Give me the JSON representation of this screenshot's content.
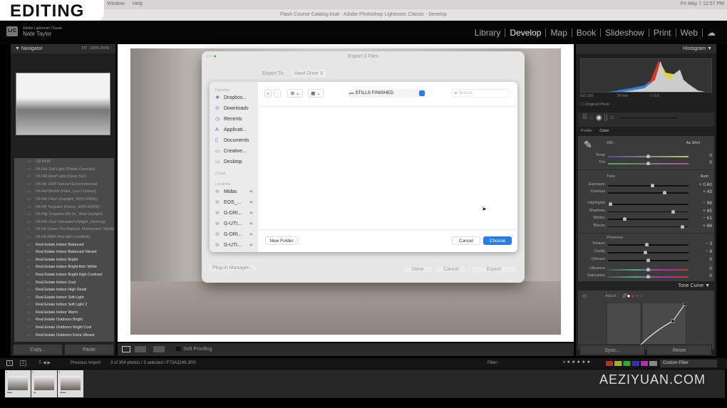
{
  "overlay_badge": "EDITING",
  "menubar": {
    "items": [
      "Window",
      "Help"
    ],
    "clock": "Fri May 7  12:57 PM"
  },
  "window_title": "Flash Course Catalog.lrcat - Adobe Photoshop Lightroom Classic - Develop",
  "identity": {
    "badge": "LrC",
    "app": "Adobe Lightroom Classic",
    "user": "Nate Taylor"
  },
  "modules": [
    {
      "label": "Library"
    },
    {
      "label": "Develop",
      "active": true
    },
    {
      "label": "Map"
    },
    {
      "label": "Book"
    },
    {
      "label": "Slideshow"
    },
    {
      "label": "Print"
    },
    {
      "label": "Web"
    }
  ],
  "left_panel": {
    "navigator": {
      "title": "Navigator",
      "zoom_options": [
        "FIT :",
        "100%",
        "300% :"
      ]
    },
    "presets": [
      {
        "label": "03j B&W",
        "dim": true
      },
      {
        "label": "04-04a Soft Light (Shade-Overcast)",
        "dim": true
      },
      {
        "label": "04-04b Hard Light (Open Sun)",
        "dim": true
      },
      {
        "label": "04-04c HDR Natural (Environmental)",
        "dim": true
      },
      {
        "label": "04-04d Backlit (Flare_Low Contrast)",
        "dim": true
      },
      {
        "label": "04-04e Flash (Daylight_5000-6000K)",
        "dim": true
      },
      {
        "label": "04-04f Tungsten (Indoor_3000-4000K)",
        "dim": true
      },
      {
        "label": "04-04g Tungsten Mix (w_ Blue Daylight)",
        "dim": true
      },
      {
        "label": "04-04h Over Saturated (Uplight_Dancing)",
        "dim": true
      },
      {
        "label": "04-04i Green Tint (Natural_Fluorescent_Window)",
        "dim": true
      },
      {
        "label": "04-04j B&W (Any light condition)",
        "dim": true
      },
      {
        "label": "Real Estate Indoor Balanced"
      },
      {
        "label": "Real Estate Indoor Balanced Vibrant"
      },
      {
        "label": "Real Estate Indoor Bright"
      },
      {
        "label": "Real Estate Indoor Bright Artic White"
      },
      {
        "label": "Real Estate Indoor Bright High Contrast"
      },
      {
        "label": "Real Estate Indoor Cool"
      },
      {
        "label": "Real Estate Indoor High Detail"
      },
      {
        "label": "Real Estate Indoor Soft Light"
      },
      {
        "label": "Real Estate Indoor Soft Light 2"
      },
      {
        "label": "Real Estate Indoor Warm"
      },
      {
        "label": "Real Estate Outdoors Bright"
      },
      {
        "label": "Real Estate Outdoors Bright Cool"
      },
      {
        "label": "Real Estate Outdoors Extra Vibrant"
      }
    ],
    "copy_label": "Copy...",
    "paste_label": "Paste"
  },
  "toolbar": {
    "soft_proofing": "Soft Proofing"
  },
  "right_panel": {
    "histogram": {
      "title": "Histogram",
      "iso": "ISO 100",
      "focal": "24 mm",
      "aperture": "f / 5.6",
      "original_photo": "Original Photo"
    },
    "profile": {
      "label": "Profile :",
      "value": "Color"
    },
    "wb": {
      "label": "WB :",
      "value": "As Shot"
    },
    "wb_sliders": [
      {
        "label": "Temp",
        "display": "0",
        "pos": 0.5
      },
      {
        "label": "Tint",
        "display": "0",
        "pos": 0.5
      }
    ],
    "tone": {
      "label": "Tone",
      "auto": "Auto"
    },
    "tone_sliders": [
      {
        "label": "Exposure",
        "display": "+ 0.60",
        "pos": 0.56
      },
      {
        "label": "Contrast",
        "display": "+ 43",
        "pos": 0.715
      }
    ],
    "tone_sliders2": [
      {
        "label": "Highlights",
        "display": "− 98",
        "pos": 0.01
      },
      {
        "label": "Shadows",
        "display": "+ 65",
        "pos": 0.825
      },
      {
        "label": "Whites",
        "display": "− 61",
        "pos": 0.195
      },
      {
        "label": "Blacks",
        "display": "+ 88",
        "pos": 0.94
      }
    ],
    "presence": {
      "label": "Presence"
    },
    "presence_sliders": [
      {
        "label": "Texture",
        "display": "− 3",
        "pos": 0.485
      },
      {
        "label": "Clarity",
        "display": "− 8",
        "pos": 0.46
      },
      {
        "label": "Dehaze",
        "display": "0",
        "pos": 0.5
      }
    ],
    "color_sliders": [
      {
        "label": "Vibrance",
        "display": "0",
        "pos": 0.5
      },
      {
        "label": "Saturation",
        "display": "0",
        "pos": 0.5
      }
    ],
    "tone_curve": {
      "title": "Tone Curve",
      "adjust": "Adjust :"
    },
    "sync_label": "Sync...",
    "reset_label": "Reset"
  },
  "filmstrip": {
    "pages": [
      "1",
      "2"
    ],
    "source": "Previous Import",
    "status": "3 of 304 photos / 3 selected / F73A3249.JPG",
    "filter_label": "Filter :",
    "custom_filter": "Custom Filter",
    "thumbnails": [
      {
        "index": "1",
        "stars": "••••"
      },
      {
        "index": "2",
        "stars": "••"
      },
      {
        "index": "3",
        "stars": "•••••"
      }
    ]
  },
  "watermark": "AEZIYUAN.COM",
  "export_dialog": {
    "title": "Export 3 Files",
    "export_to_label": "Export To:",
    "export_to_value": "Hard Drive",
    "plugin_manager": "Plug-in Manager...",
    "done": "Done",
    "cancel": "Cancel",
    "export": "Export",
    "picker": {
      "favorites_label": "Favorites",
      "favorites": [
        {
          "label": "Dropbox...",
          "icon": "dropbox-icon",
          "glyph": "❖"
        },
        {
          "label": "Downloads",
          "icon": "downloads-icon",
          "glyph": "⊙"
        },
        {
          "label": "Recents",
          "icon": "clock-icon",
          "glyph": "◷"
        },
        {
          "label": "Applicati...",
          "icon": "applications-icon",
          "glyph": "A"
        },
        {
          "label": "Documents",
          "icon": "document-icon",
          "glyph": "▯"
        },
        {
          "label": "Creative...",
          "icon": "folder-icon",
          "glyph": "▭"
        },
        {
          "label": "Desktop",
          "icon": "desktop-icon",
          "glyph": "▭"
        }
      ],
      "icloud_label": "iCloud",
      "locations_label": "Locations",
      "locations": [
        {
          "label": "Midas"
        },
        {
          "label": "EOS_..."
        },
        {
          "label": "G-DRI..."
        },
        {
          "label": "G-UTI..."
        },
        {
          "label": "G-DRI..."
        },
        {
          "label": "G-UTI..."
        }
      ],
      "folder": "STILLS FINISHED",
      "search_placeholder": "Search",
      "new_folder": "New Folder",
      "cancel": "Cancel",
      "choose": "Choose",
      "accent": "#2a7de1"
    }
  }
}
